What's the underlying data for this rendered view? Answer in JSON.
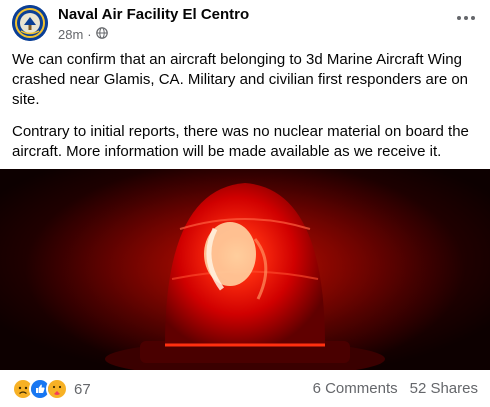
{
  "post": {
    "page_name": "Naval Air Facility El Centro",
    "time": "28m",
    "separator": "·",
    "paragraphs": [
      "We can confirm that an aircraft belonging to 3d Marine Aircraft Wing crashed near Glamis, CA. Military and civilian first responders are on site.",
      "Contrary to initial reports, there was no nuclear material on board the aircraft. More information will be made available as we receive it."
    ],
    "icons": {
      "more": "more-options-icon",
      "audience": "globe-icon",
      "avatar": "navy-seal-logo"
    }
  },
  "footer": {
    "reaction_count": "67",
    "reactions": [
      "sad",
      "like",
      "care"
    ],
    "comments": "6 Comments",
    "shares": "52 Shares"
  },
  "colors": {
    "beacon_red": "#ff1a0a",
    "meta_gray": "#65676b",
    "like_blue": "#1877f2",
    "sad_yellow": "#f7b125"
  }
}
